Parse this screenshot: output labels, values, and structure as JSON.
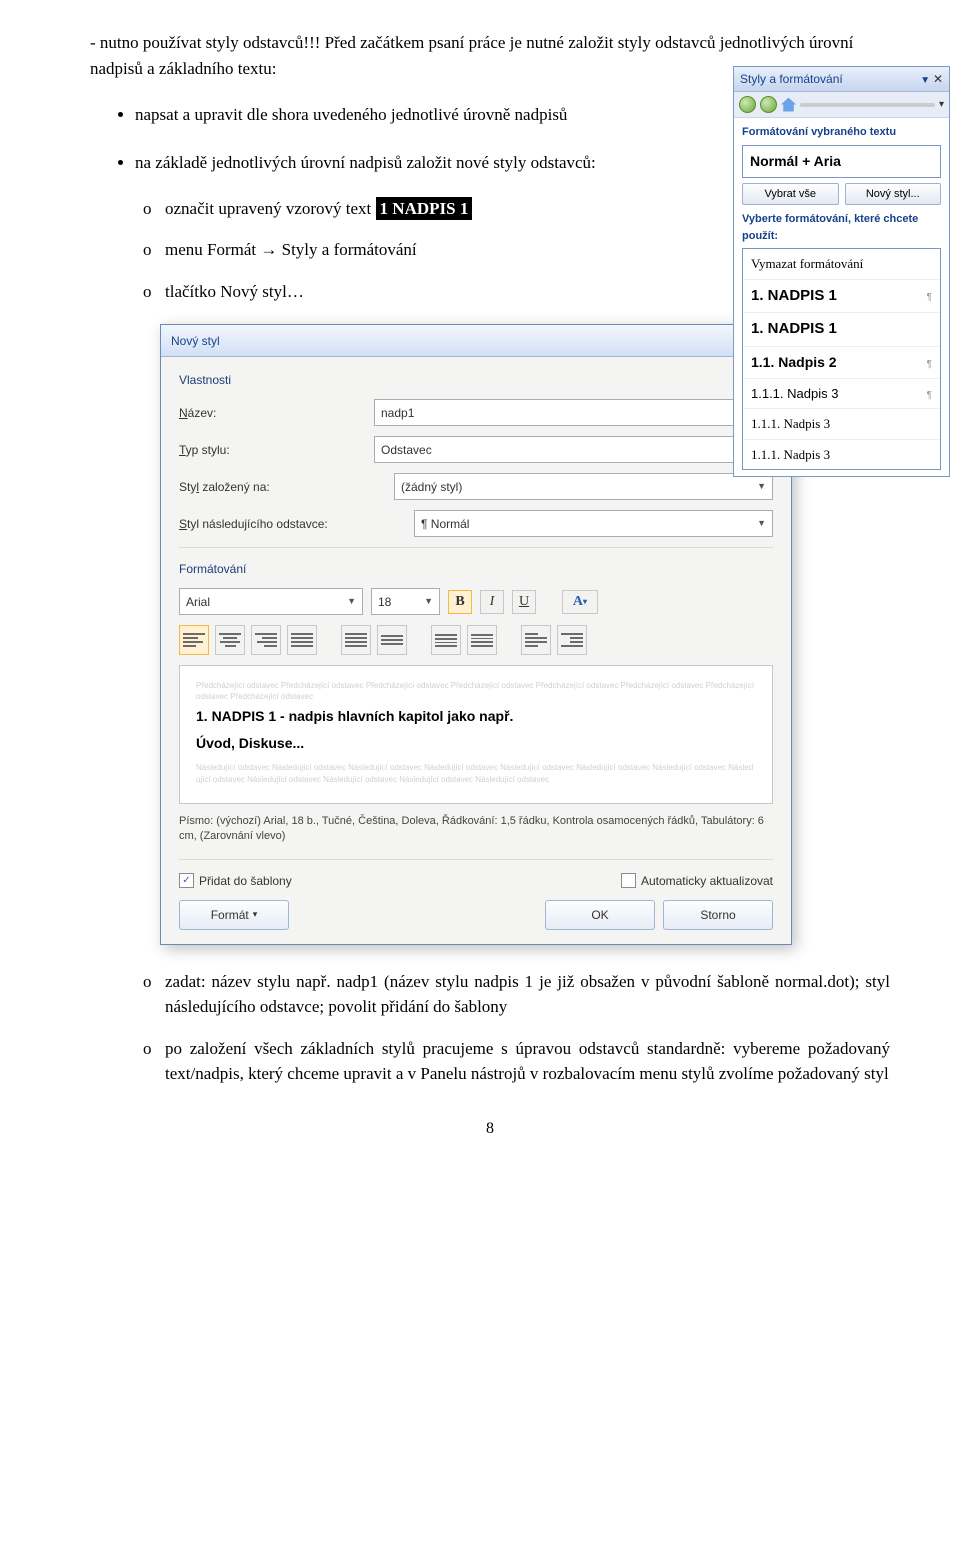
{
  "text": {
    "dash1": "nutno používat styly odstavců!!! Před začátkem psaní práce je nutné založit styly odstavců jednotlivých úrovní nadpisů a základního textu:",
    "b1": "napsat a upravit dle shora uvedeného jednotlivé úrovně nadpisů",
    "b2": "na základě jednotlivých úrovní nadpisů založit nové styly odstavců:",
    "c1a": "označit upravený vzorový text ",
    "c1hl": "1 NADPIS 1",
    "c2": "menu Formát → Styly a formátování",
    "c3": "tlačítko Nový styl…",
    "c4": "zadat: název stylu např. nadp1 (název stylu nadpis 1 je již obsažen v původní šabloně normal.dot); styl následujícího odstavce; povolit přidání do šablony",
    "c5": "po založení všech základních stylů pracujeme s úpravou odstavců standardně: vybereme požadovaný text/nadpis, který chceme upravit a v Panelu nástrojů v rozbalovacím menu stylů zvolíme požadovaný styl"
  },
  "side": {
    "title": "Styly a formátování",
    "sec1": "Formátování vybraného textu",
    "current": "Normál + Aria",
    "btn_all": "Vybrat vše",
    "btn_new": "Nový styl...",
    "sec2": "Vyberte formátování, které chcete použít:",
    "items": [
      {
        "t": "Vymazat formátování",
        "cls": "f1",
        "m": ""
      },
      {
        "t": "1. NADPIS 1",
        "cls": "t1",
        "m": "¶"
      },
      {
        "t": "1. NADPIS 1",
        "cls": "t1",
        "m": ""
      },
      {
        "t": "1.1. Nadpis 2",
        "cls": "t2",
        "m": "¶"
      },
      {
        "t": "1.1.1. Nadpis 3",
        "cls": "t3",
        "m": "¶"
      },
      {
        "t": "1.1.1. Nadpis 3",
        "cls": "f1",
        "m": ""
      },
      {
        "t": "1.1.1. Nadpis 3",
        "cls": "f1",
        "m": ""
      }
    ]
  },
  "dialog": {
    "title": "Nový styl",
    "grp1": "Vlastnosti",
    "lbl_name": "Název:",
    "val_name": "nadp1",
    "lbl_type": "Typ stylu:",
    "val_type": "Odstavec",
    "lbl_based": "Styl založený na:",
    "val_based": "(žádný styl)",
    "lbl_next": "Styl následujícího odstavce:",
    "val_next": "¶ Normál",
    "grp2": "Formátování",
    "font": "Arial",
    "size": "18",
    "ghost1": "Předcházející odstavec Předcházející odstavec Předcházející odstavec Předcházející odstavec Předcházející odstavec Předcházející odstavec Předcházející odstavec Předcházející odstavec",
    "prev_main": "1. NADPIS 1           - nadpis hlavních kapitol jako např.",
    "prev_main2": "Úvod, Diskuse...",
    "ghost2": "Následující odstavec Následující odstavec Následující odstavec Následující odstavec Následující odstavec Následující odstavec Následující odstavec Následující odstavec Následující odstavec Následující odstavec Následující odstavec Následující odstavec",
    "desc": "Písmo: (výchozí) Arial, 18 b., Tučné, Čeština, Doleva, Řádkování:  1,5 řádku, Kontrola osamocených řádků, Tabulátory:  6 cm, (Zarovnání vlevo)",
    "chk_template": "Přidat do šablony",
    "chk_auto": "Automaticky aktualizovat",
    "btn_format": "Formát",
    "btn_ok": "OK",
    "btn_cancel": "Storno"
  },
  "pagenum": "8"
}
